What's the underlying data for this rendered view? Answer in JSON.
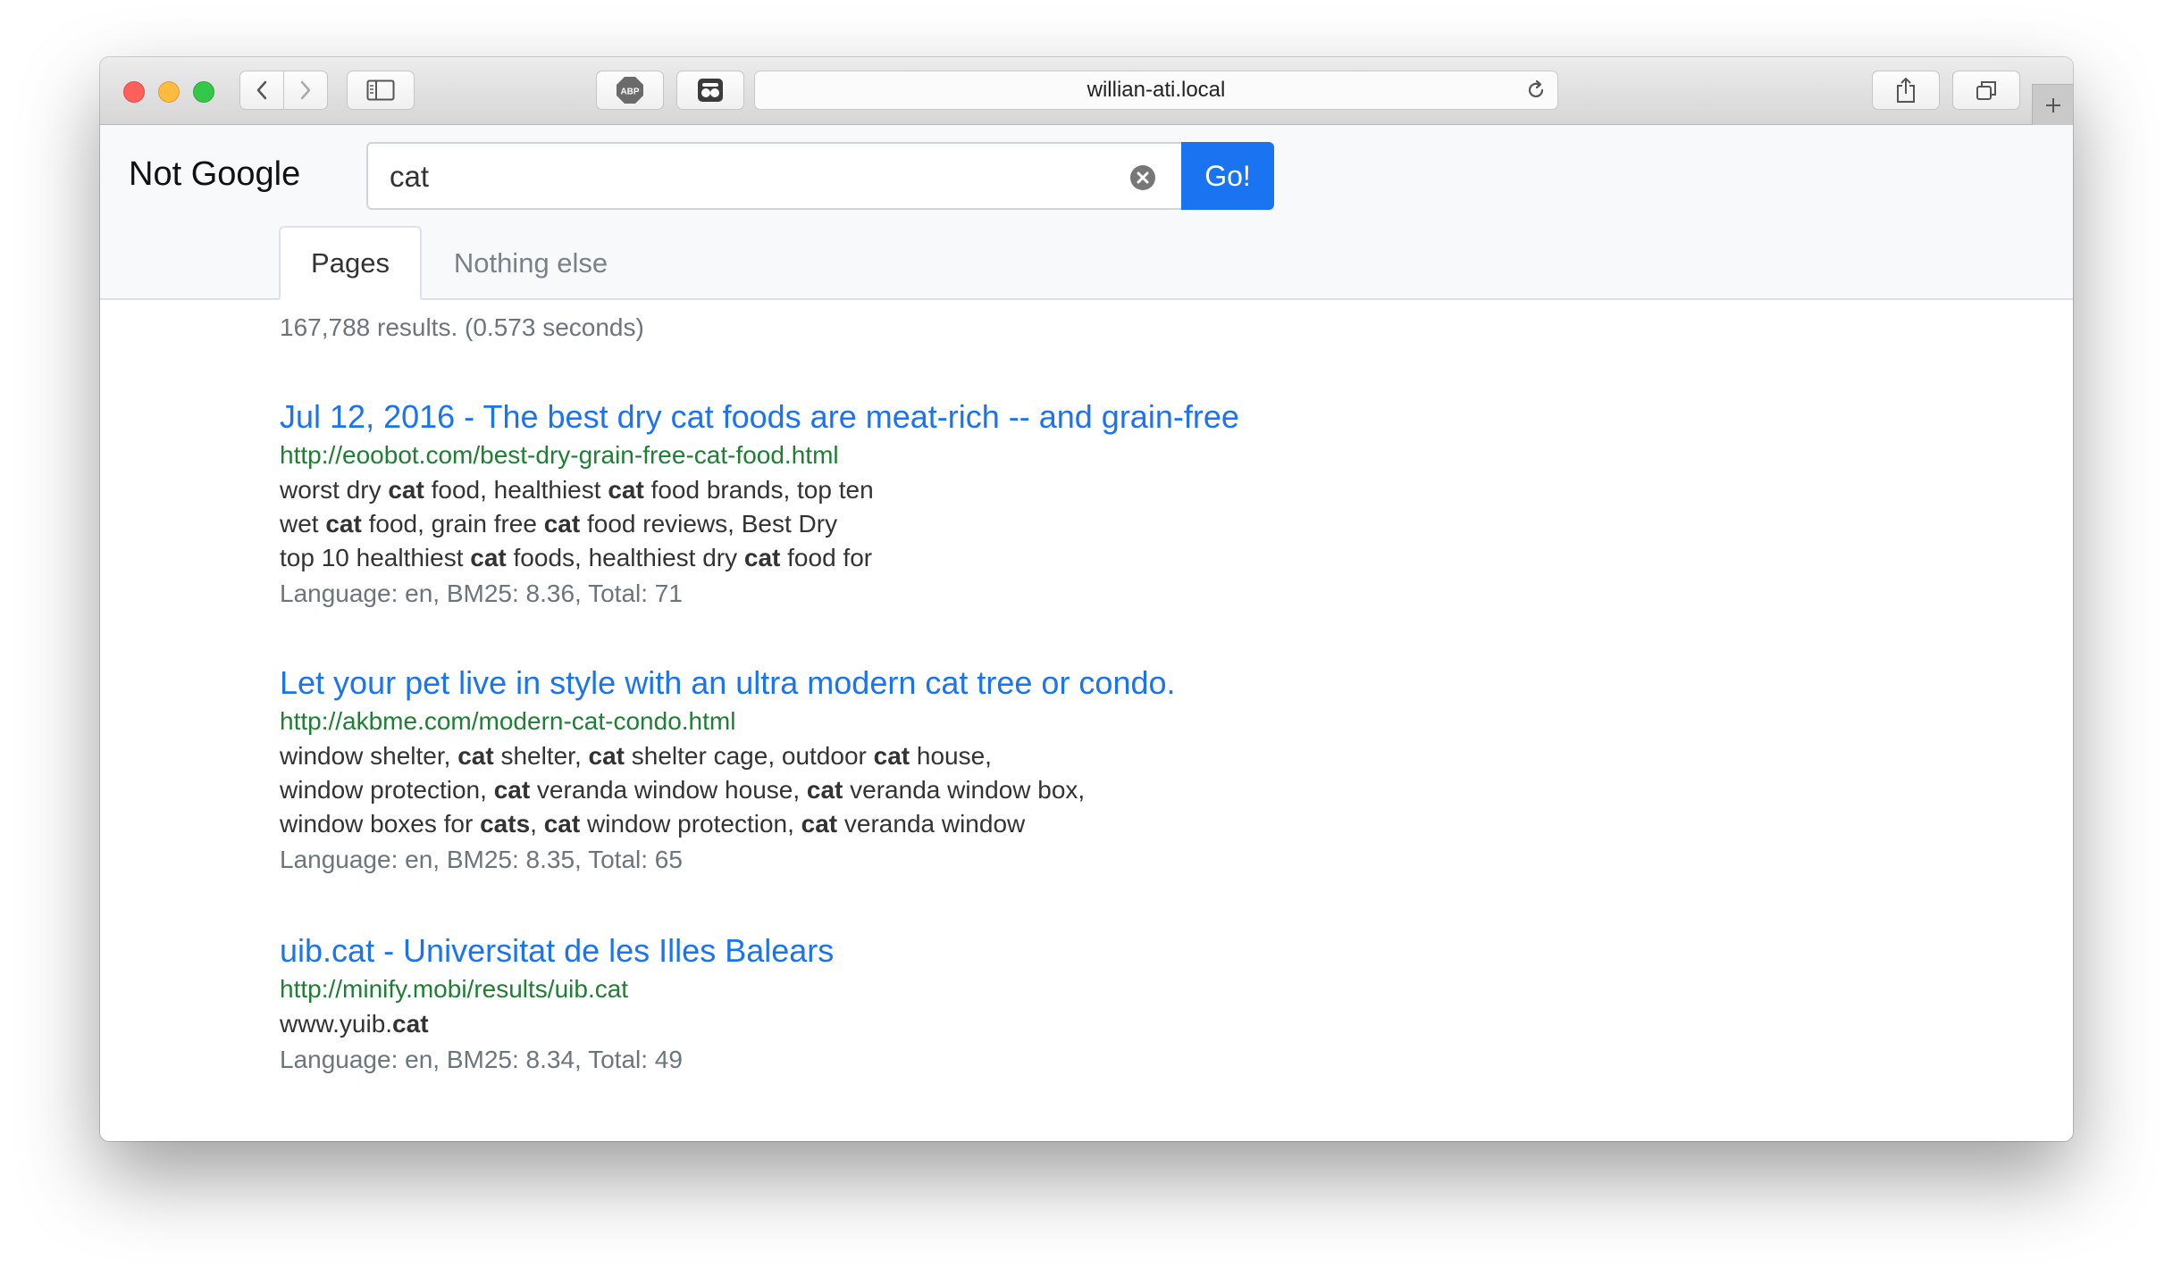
{
  "browser": {
    "url": "willian-ati.local",
    "toolbar_icons": [
      "back-icon",
      "forward-icon",
      "sidebar-icon",
      "adblock-icon",
      "extension-icon",
      "reload-icon",
      "share-icon",
      "tabs-icon",
      "new-tab-icon"
    ],
    "adblock_label": "ABP"
  },
  "app": {
    "brand": "Not Google",
    "search": {
      "value": "cat",
      "button_label": "Go!"
    },
    "tabs": [
      {
        "label": "Pages",
        "active": true
      },
      {
        "label": "Nothing else",
        "active": false
      }
    ],
    "stats": "167,788 results. (0.573 seconds)"
  },
  "colors": {
    "accent": "#1a74f2",
    "url_green": "#1e7e34",
    "muted": "#6c757d"
  },
  "results": [
    {
      "title": "Jul 12, 2016 - The best dry cat foods are meat-rich -- and grain-free",
      "url": "http://eoobot.com/best-dry-grain-free-cat-food.html",
      "snippet": [
        [
          {
            "t": "worst dry ",
            "b": false
          },
          {
            "t": "cat",
            "b": true
          },
          {
            "t": " food, healthiest ",
            "b": false
          },
          {
            "t": "cat",
            "b": true
          },
          {
            "t": " food brands, top ten",
            "b": false
          }
        ],
        [
          {
            "t": "wet ",
            "b": false
          },
          {
            "t": "cat",
            "b": true
          },
          {
            "t": " food, grain free ",
            "b": false
          },
          {
            "t": "cat",
            "b": true
          },
          {
            "t": " food reviews, Best Dry",
            "b": false
          }
        ],
        [
          {
            "t": "top 10 healthiest ",
            "b": false
          },
          {
            "t": "cat",
            "b": true
          },
          {
            "t": " foods, healthiest dry ",
            "b": false
          },
          {
            "t": "cat",
            "b": true
          },
          {
            "t": " food for",
            "b": false
          }
        ]
      ],
      "meta": "Language: en, BM25: 8.36, Total: 71"
    },
    {
      "title": "Let your pet live in style with an ultra modern cat tree or condo.",
      "url": "http://akbme.com/modern-cat-condo.html",
      "snippet": [
        [
          {
            "t": "window shelter, ",
            "b": false
          },
          {
            "t": "cat",
            "b": true
          },
          {
            "t": " shelter, ",
            "b": false
          },
          {
            "t": "cat",
            "b": true
          },
          {
            "t": " shelter cage, outdoor ",
            "b": false
          },
          {
            "t": "cat",
            "b": true
          },
          {
            "t": " house,",
            "b": false
          }
        ],
        [
          {
            "t": "window protection, ",
            "b": false
          },
          {
            "t": "cat",
            "b": true
          },
          {
            "t": " veranda window house, ",
            "b": false
          },
          {
            "t": "cat",
            "b": true
          },
          {
            "t": " veranda window box,",
            "b": false
          }
        ],
        [
          {
            "t": "window boxes for ",
            "b": false
          },
          {
            "t": "cats",
            "b": true
          },
          {
            "t": ", ",
            "b": false
          },
          {
            "t": "cat",
            "b": true
          },
          {
            "t": " window protection, ",
            "b": false
          },
          {
            "t": "cat",
            "b": true
          },
          {
            "t": " veranda window",
            "b": false
          }
        ]
      ],
      "meta": "Language: en, BM25: 8.35, Total: 65"
    },
    {
      "title": "uib.cat - Universitat de les Illes Balears",
      "url": "http://minify.mobi/results/uib.cat",
      "snippet": [
        [
          {
            "t": "www.yuib.",
            "b": false
          },
          {
            "t": "cat",
            "b": true
          }
        ]
      ],
      "meta": "Language: en, BM25: 8.34, Total: 49"
    }
  ]
}
